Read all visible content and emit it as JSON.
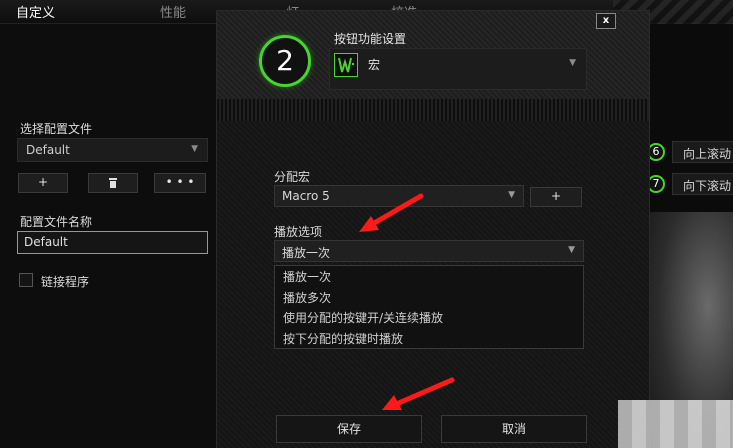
{
  "nav": {
    "tabs": [
      "自定义",
      "性能",
      "灯",
      "校准"
    ]
  },
  "left": {
    "profile_label": "选择配置文件",
    "profile_value": "Default",
    "add_label": "+",
    "delete_icon": "trash-icon",
    "more_label": "• • •",
    "name_label": "配置文件名称",
    "name_value": "Default",
    "link_label": "链接程序"
  },
  "right": {
    "items": [
      {
        "num": "6",
        "label": "向上滚动"
      },
      {
        "num": "7",
        "label": "向下滚动"
      }
    ]
  },
  "modal": {
    "close_label": "x",
    "button_number": "2",
    "function_title": "按钮功能设置",
    "function_value": "宏",
    "assign_label": "分配宏",
    "macro_value": "Macro 5",
    "macro_add_label": "+",
    "play_label": "播放选项",
    "play_value": "播放一次",
    "play_options": [
      "播放一次",
      "播放多次",
      "使用分配的按键开/关连续播放",
      "按下分配的按键时播放"
    ],
    "save_label": "保存",
    "cancel_label": "取消"
  },
  "colors": {
    "accent": "#44d62c",
    "annotation": "#ff1a1a"
  }
}
